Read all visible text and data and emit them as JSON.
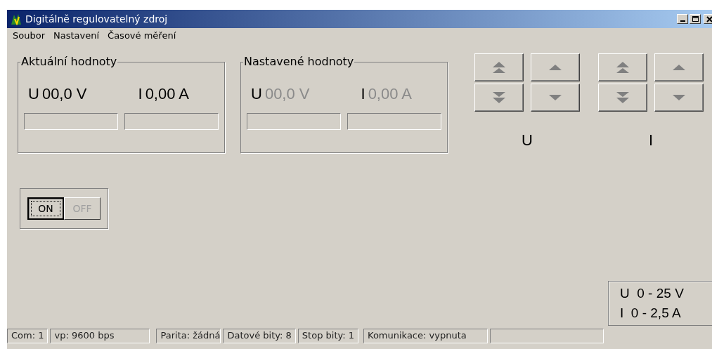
{
  "window": {
    "title": "Digitálně regulovatelný zdroj"
  },
  "menu": [
    "Soubor",
    "Nastavení",
    "Časové měření"
  ],
  "groups": [
    {
      "title": "Aktuální hodnoty",
      "disabled": false,
      "readings": [
        {
          "symbol": "U",
          "value": "00,0 V",
          "level": 0
        },
        {
          "symbol": "I",
          "value": "0,00 A",
          "level": 0
        }
      ]
    },
    {
      "title": "Nastavené hodnoty",
      "disabled": true,
      "readings": [
        {
          "symbol": "U",
          "value": "00,0 V",
          "level": 0
        },
        {
          "symbol": "I",
          "value": "0,00 A",
          "level": 0
        }
      ]
    }
  ],
  "steppers": [
    {
      "label": "U",
      "buttons": [
        {
          "kind": "fast-up"
        },
        {
          "kind": "up"
        },
        {
          "kind": "fast-down"
        },
        {
          "kind": "down"
        }
      ]
    },
    {
      "label": "I",
      "buttons": [
        {
          "kind": "fast-up"
        },
        {
          "kind": "up"
        },
        {
          "kind": "fast-down"
        },
        {
          "kind": "down"
        }
      ]
    }
  ],
  "power": [
    {
      "label": "ON",
      "selected": true
    },
    {
      "label": "OFF",
      "selected": false
    }
  ],
  "ranges": [
    "U  0 - 25 V",
    "I  0 - 2,5 A"
  ],
  "status_bar": [
    "Com: 1",
    "vp: 9600 bps",
    "Parita: žádná",
    "Datové bity: 8",
    "Stop bity: 1",
    "Komunikace: vypnuta"
  ]
}
